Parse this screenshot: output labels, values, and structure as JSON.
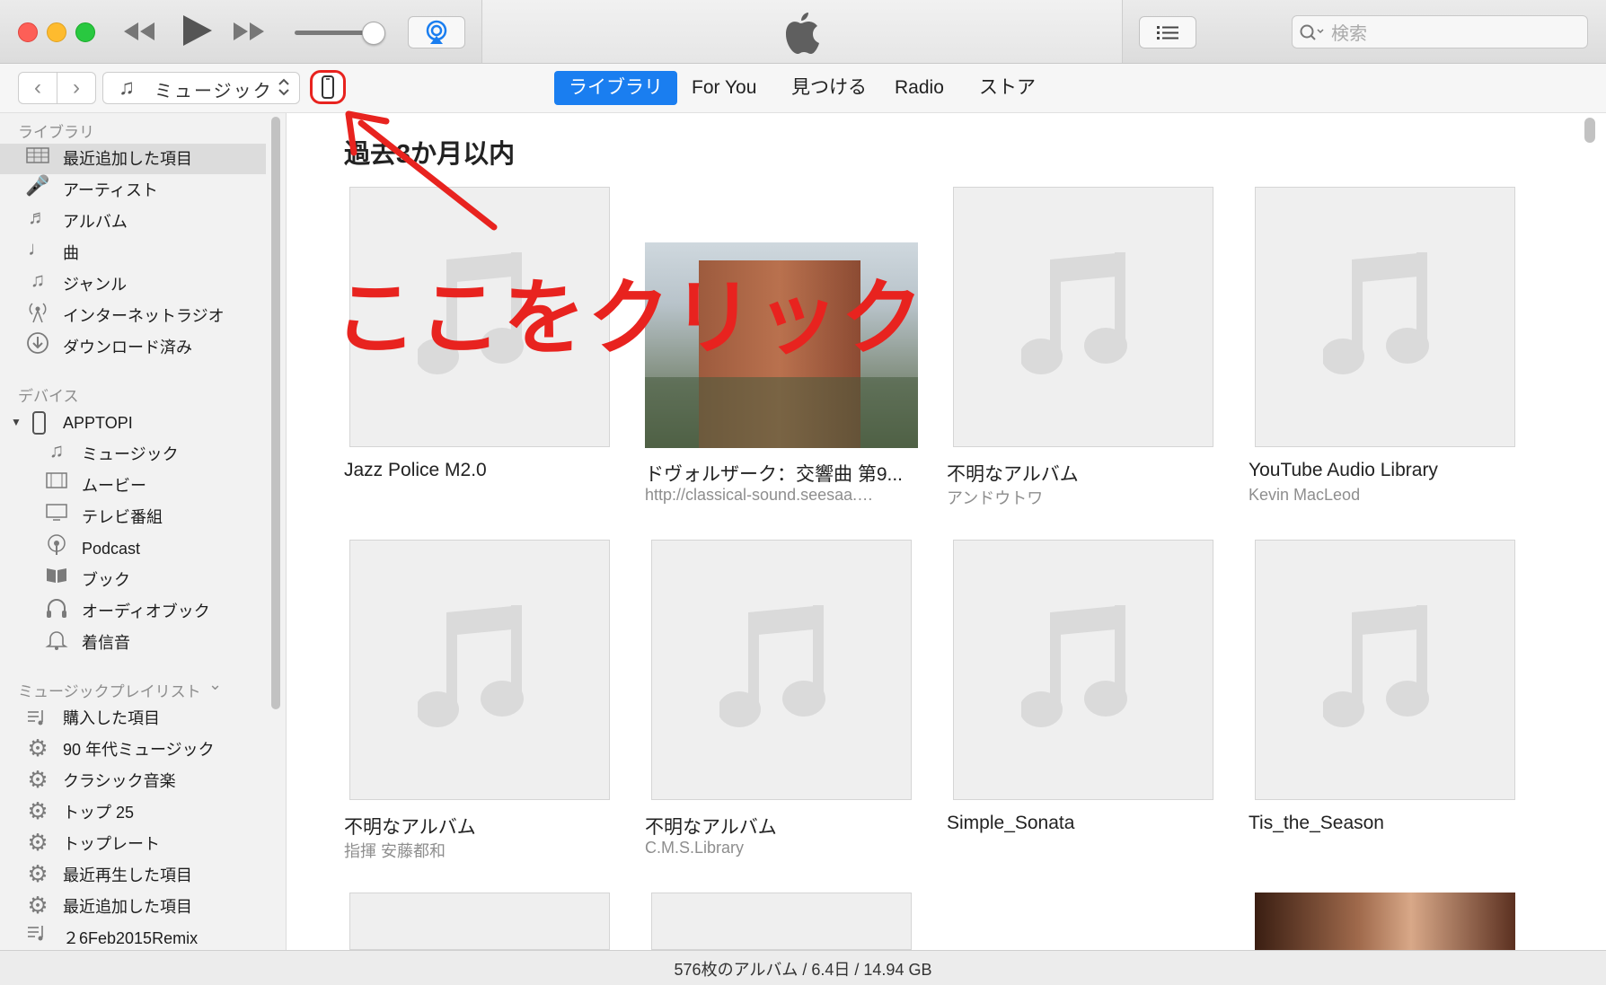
{
  "window": {
    "traffic_colors": [
      "#fd5f57",
      "#febb2e",
      "#29c840"
    ],
    "search_placeholder": "検索"
  },
  "toolbar": {
    "prev_icon": "rewind-icon",
    "play_icon": "play-icon",
    "next_icon": "fast-forward-icon",
    "airplay_icon": "airplay-icon",
    "apple_logo": "apple-logo-icon",
    "list_icon": "list-view-icon",
    "volume_level": 0.85
  },
  "nav": {
    "back": "‹",
    "forward": "›",
    "media_kind": "ミュージック",
    "tabs": [
      "ライブラリ",
      "For You",
      "見つける",
      "Radio",
      "ストア"
    ],
    "active_tab": 0
  },
  "sidebar": {
    "library_header": "ライブラリ",
    "library_items": [
      "最近追加した項目",
      "アーティスト",
      "アルバム",
      "曲",
      "ジャンル",
      "インターネットラジオ",
      "ダウンロード済み"
    ],
    "devices_header": "デバイス",
    "device_name": "APPTOPI",
    "device_items": [
      "ミュージック",
      "ムービー",
      "テレビ番組",
      "Podcast",
      "ブック",
      "オーディオブック",
      "着信音"
    ],
    "playlists_header": "ミュージックプレイリスト",
    "playlists_chevron": "⌄",
    "playlist_items": [
      "購入した項目",
      "90 年代ミュージック",
      "クラシック音楽",
      "トップ 25",
      "トップレート",
      "最近再生した項目",
      "最近追加した項目",
      "２6Feb2015Remix"
    ]
  },
  "main": {
    "section_title": "過去3か月以内",
    "albums": [
      {
        "title": "Jazz Police M2.0",
        "artist": ""
      },
      {
        "title": "ドヴォルザーク：交響曲 第9...",
        "artist": "http://classical-sound.seesaa.…"
      },
      {
        "title": "不明なアルバム",
        "artist": "アンドウトワ"
      },
      {
        "title": "YouTube Audio Library",
        "artist": "Kevin MacLeod"
      },
      {
        "title": "不明なアルバム",
        "artist": "指揮 安藤都和"
      },
      {
        "title": "不明なアルバム",
        "artist": "C.M.S.Library"
      },
      {
        "title": "Simple_Sonata",
        "artist": ""
      },
      {
        "title": "Tis_the_Season",
        "artist": ""
      }
    ]
  },
  "status": {
    "text": "576枚のアルバム / 6.4日 / 14.94 GB"
  },
  "annotation": {
    "text": "ここをクリック",
    "color": "#e8231f"
  },
  "accent": "#1a7ef0"
}
